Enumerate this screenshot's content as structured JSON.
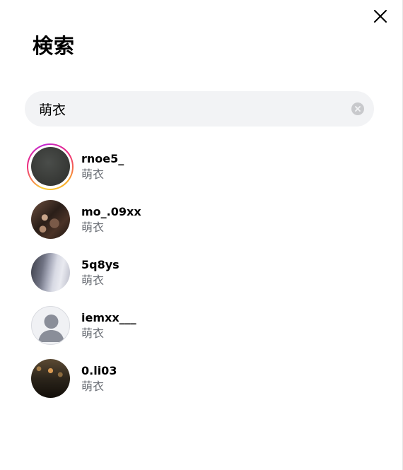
{
  "panel": {
    "title": "検索"
  },
  "search": {
    "value": "萌衣",
    "placeholder": "検索"
  },
  "icons": {
    "close": "close-icon",
    "clear": "clear-circle-icon",
    "default_avatar": "default-avatar-icon"
  },
  "colors": {
    "search_bg": "#f2f3f5",
    "secondary_text": "#6b6f76",
    "story_ring_start": "#f9ce34",
    "story_ring_mid": "#ee2a7b",
    "story_ring_end": "#c026d3"
  },
  "results": [
    {
      "username": "rnoe5_",
      "fullname": "萌衣",
      "has_story": true
    },
    {
      "username": "mo_.09xx",
      "fullname": "萌衣",
      "has_story": false
    },
    {
      "username": "5q8ys",
      "fullname": "萌衣",
      "has_story": false
    },
    {
      "username": "iemxx___",
      "fullname": "萌衣",
      "has_story": false,
      "default_avatar": true
    },
    {
      "username": "0.li03",
      "fullname": "萌衣",
      "has_story": false
    }
  ]
}
